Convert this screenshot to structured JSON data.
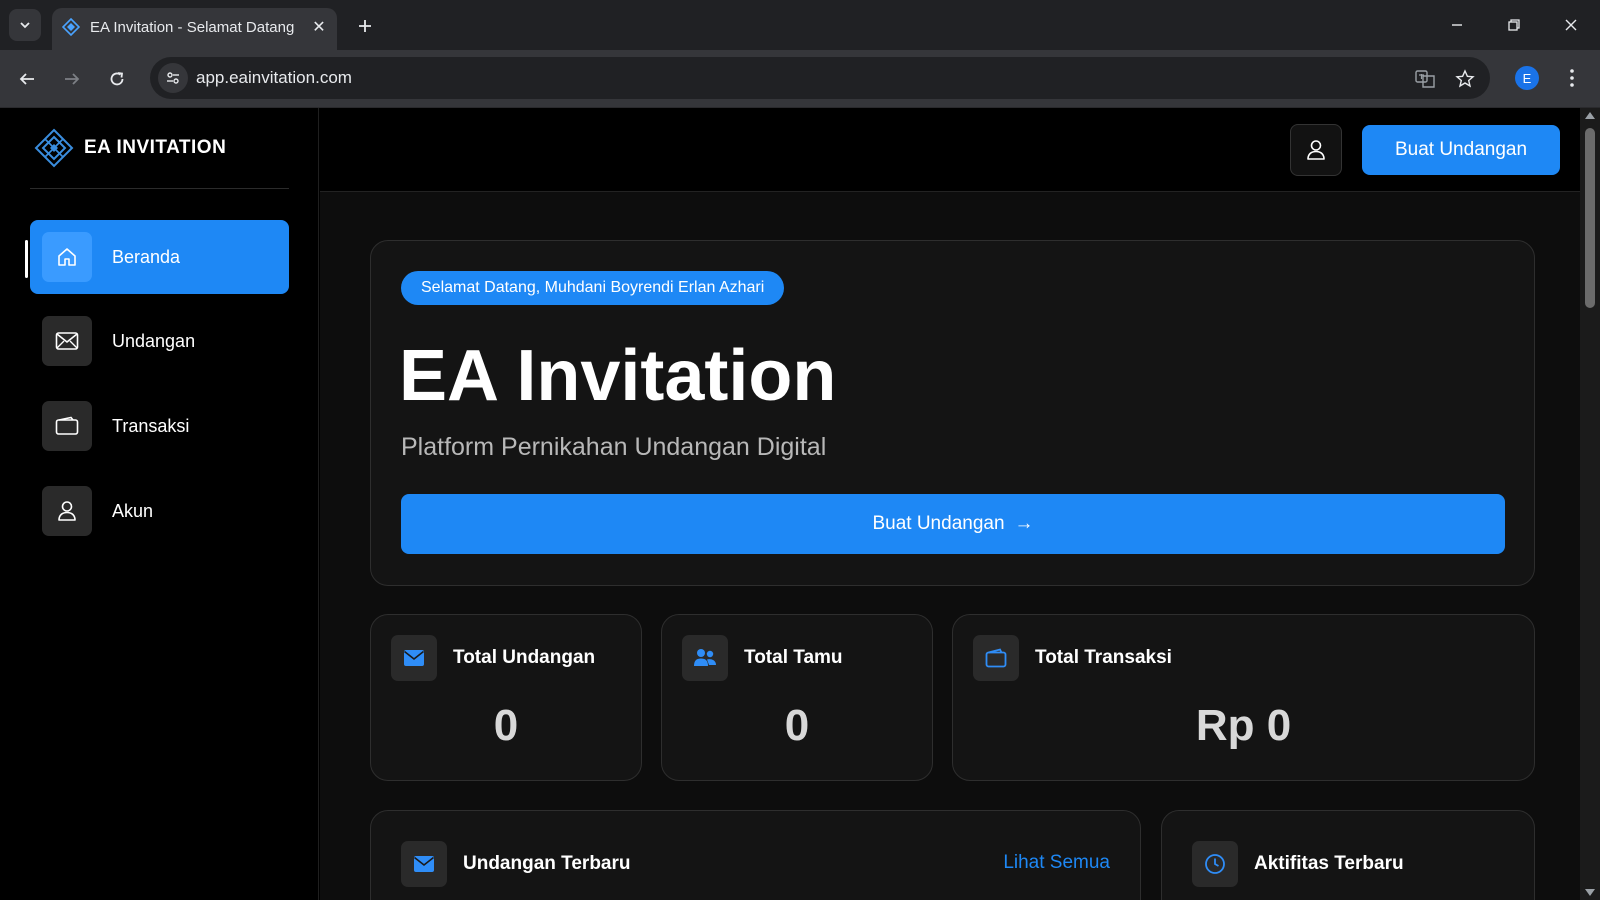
{
  "browser": {
    "tab_title": "EA Invitation - Selamat Datang",
    "url": "app.eainvitation.com",
    "profile_initial": "E"
  },
  "sidebar": {
    "brand": "EA INVITATION",
    "items": [
      {
        "label": "Beranda",
        "icon": "home-icon",
        "active": true
      },
      {
        "label": "Undangan",
        "icon": "mail-icon",
        "active": false
      },
      {
        "label": "Transaksi",
        "icon": "wallet-icon",
        "active": false
      },
      {
        "label": "Akun",
        "icon": "user-icon",
        "active": false
      }
    ]
  },
  "header": {
    "cta_label": "Buat Undangan"
  },
  "hero": {
    "badge": "Selamat Datang, Muhdani Boyrendi Erlan Azhari",
    "title": "EA Invitation",
    "subtitle": "Platform Pernikahan Undangan Digital",
    "cta_label": "Buat Undangan",
    "cta_arrow": "→"
  },
  "stats": [
    {
      "title": "Total Undangan",
      "value": "0",
      "icon": "mail-icon"
    },
    {
      "title": "Total Tamu",
      "value": "0",
      "icon": "users-icon"
    },
    {
      "title": "Total Transaksi",
      "value": "Rp 0",
      "icon": "wallet-icon"
    }
  ],
  "panels": {
    "recent_invitations": {
      "title": "Undangan Terbaru",
      "link": "Lihat Semua"
    },
    "recent_activity": {
      "title": "Aktifitas Terbaru"
    }
  },
  "colors": {
    "accent": "#1e88f5",
    "background": "#0d0d0d",
    "card": "#141414"
  }
}
